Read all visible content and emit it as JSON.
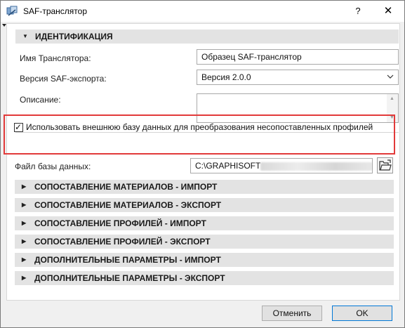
{
  "window": {
    "title": "SAF-транслятор",
    "help_label": "?",
    "close_label": "✕"
  },
  "identification": {
    "header": "ИДЕНТИФИКАЦИЯ",
    "translator_name_label": "Имя Транслятора:",
    "translator_name_value": "Образец SAF-транслятор",
    "saf_version_label": "Версия SAF-экспорта:",
    "saf_version_value": "Версия 2.0.0",
    "description_label": "Описание:",
    "description_value": ""
  },
  "external_db": {
    "checkbox_checked": true,
    "checkbox_label": "Использовать внешнюю базу данных для преобразования несопоставленных профилей",
    "file_label": "Файл базы данных:",
    "file_value_prefix": "C:\\GRAPHISOFT"
  },
  "sections": [
    {
      "label": "СОПОСТАВЛЕНИЕ МАТЕРИАЛОВ - ИМПОРТ"
    },
    {
      "label": "СОПОСТАВЛЕНИЕ МАТЕРИАЛОВ - ЭКСПОРТ"
    },
    {
      "label": "СОПОСТАВЛЕНИЕ ПРОФИЛЕЙ - ИМПОРТ"
    },
    {
      "label": "СОПОСТАВЛЕНИЕ ПРОФИЛЕЙ - ЭКСПОРТ"
    },
    {
      "label": "ДОПОЛНИТЕЛЬНЫЕ ПАРАМЕТРЫ - ИМПОРТ"
    },
    {
      "label": "ДОПОЛНИТЕЛЬНЫЕ ПАРАМЕТРЫ - ЭКСПОРТ"
    }
  ],
  "buttons": {
    "cancel": "Отменить",
    "ok": "OK"
  },
  "colors": {
    "highlight_border": "#e23a3a",
    "ok_border": "#0078d7"
  }
}
